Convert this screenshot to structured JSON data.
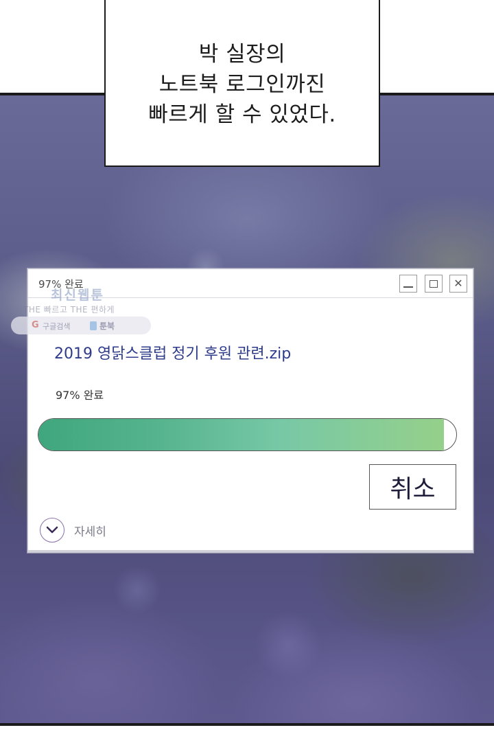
{
  "caption": {
    "lines": [
      "박 실장의",
      "노트북 로그인까진",
      "빠르게 할 수 있었다."
    ]
  },
  "dialog": {
    "title": "97% 완료",
    "file_name": "2019 영닭스클럽 정기 후원 관련.zip",
    "progress_text": "97% 완료",
    "progress_percent": 97,
    "cancel_label": "취소",
    "details_label": "자세히",
    "icons": {
      "minimize": "minimize-icon",
      "maximize": "maximize-icon",
      "close": "close-icon",
      "details": "chevron-down-icon"
    },
    "colors": {
      "progress_start": "#3fa67d",
      "progress_end": "#95d08a",
      "file_name": "#2d3b8a"
    }
  },
  "watermark": {
    "title": "최신웹툰",
    "tagline": "THE 빠르고 THE 편하게",
    "search_label": "구글검색",
    "toon_label": "툰북"
  }
}
